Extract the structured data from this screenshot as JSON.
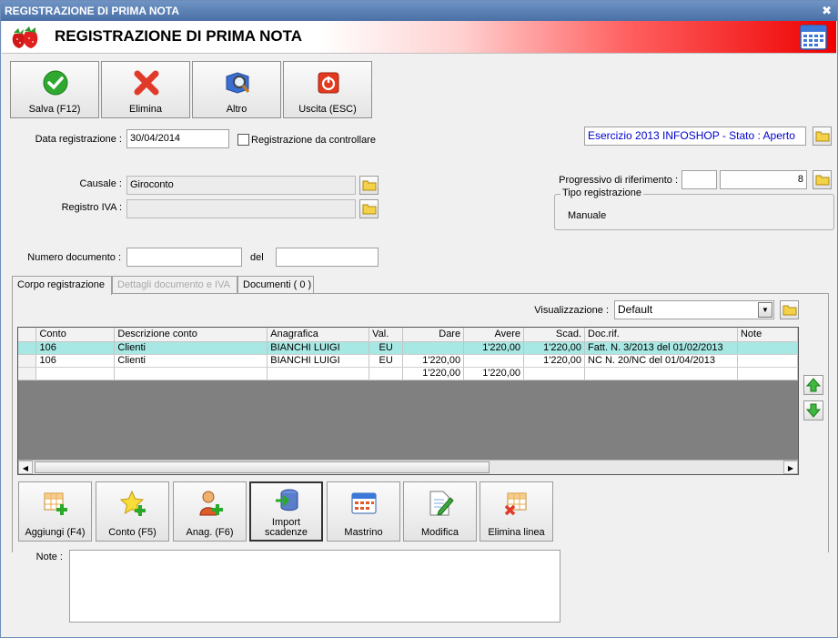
{
  "window": {
    "title": "REGISTRAZIONE DI PRIMA NOTA"
  },
  "banner": {
    "title": "REGISTRAZIONE DI PRIMA NOTA"
  },
  "toolbar": {
    "save_label": "Salva (F12)",
    "delete_label": "Elimina",
    "other_label": "Altro",
    "exit_label": "Uscita (ESC)"
  },
  "form": {
    "date_label": "Data registrazione :",
    "date_value": "30/04/2014",
    "check_label": "Registrazione da controllare",
    "esercizio": "Esercizio 2013 INFOSHOP - Stato : Aperto",
    "causale_label": "Causale :",
    "causale_value": "Giroconto",
    "registro_label": "Registro IVA :",
    "registro_value": "",
    "progressivo_label": "Progressivo di riferimento :",
    "progressivo_left": "",
    "progressivo_value": "8",
    "tipo_legend": "Tipo registrazione",
    "tipo_value": "Manuale",
    "numdoc_label": "Numero documento :",
    "numdoc_value": "",
    "del_label": "del",
    "del_value": ""
  },
  "tabs": [
    {
      "label": "Corpo registrazione"
    },
    {
      "label": "Dettagli documento e IVA"
    },
    {
      "label": "Documenti ( 0 )"
    }
  ],
  "view": {
    "label": "Visualizzazione :",
    "selected": "Default"
  },
  "grid": {
    "columns": [
      "Conto",
      "Descrizione conto",
      "Anagrafica",
      "Val.",
      "Dare",
      "Avere",
      "Scad.",
      "Doc.rif.",
      "Note"
    ],
    "rows": [
      {
        "conto": "106",
        "descr": "Clienti",
        "anag": "BIANCHI LUIGI",
        "val": "EU",
        "dare": "",
        "avere": "1'220,00",
        "scad": "1'220,00",
        "docrif": "Fatt. N. 3/2013 del 01/02/2013",
        "note": ""
      },
      {
        "conto": "106",
        "descr": "Clienti",
        "anag": "BIANCHI LUIGI",
        "val": "EU",
        "dare": "1'220,00",
        "avere": "",
        "scad": "1'220,00",
        "docrif": "NC N. 20/NC del 01/04/2013",
        "note": ""
      }
    ],
    "totals": {
      "dare": "1'220,00",
      "avere": "1'220,00"
    }
  },
  "actions": {
    "add_label": "Aggiungi (F4)",
    "conto_label": "Conto (F5)",
    "anag_label": "Anag. (F6)",
    "import_label_1": "Import",
    "import_label_2": "scadenze",
    "mastrino_label": "Mastrino",
    "modifica_label": "Modifica",
    "elimina_label": "Elimina linea"
  },
  "notes": {
    "label": "Note :",
    "value": ""
  }
}
